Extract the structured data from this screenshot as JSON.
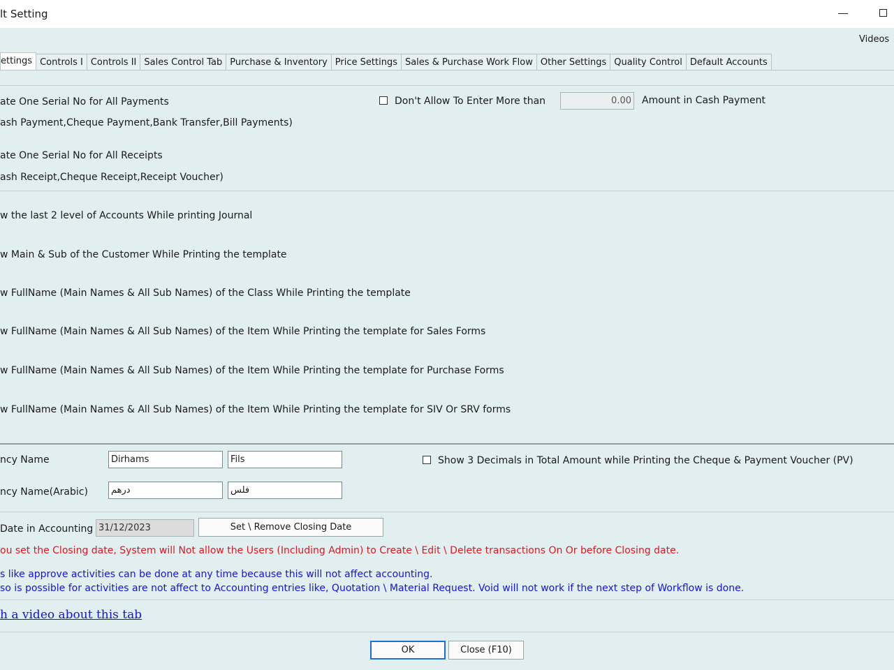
{
  "window": {
    "title": "lt Setting"
  },
  "header": {
    "videos_link": "Videos"
  },
  "tabs": [
    {
      "label": "ettings",
      "active": true
    },
    {
      "label": "Controls I"
    },
    {
      "label": "Controls II"
    },
    {
      "label": "Sales Control Tab"
    },
    {
      "label": "Purchase & Inventory"
    },
    {
      "label": "Price Settings"
    },
    {
      "label": "Sales & Purchase Work Flow"
    },
    {
      "label": "Other Settings"
    },
    {
      "label": "Quality Control"
    },
    {
      "label": "Default Accounts"
    }
  ],
  "serial": {
    "payments_label": "ate One Serial No for All Payments",
    "payments_desc": "ash Payment,Cheque Payment,Bank Transfer,Bill Payments)",
    "receipts_label": "ate One Serial No for All Receipts",
    "receipts_desc": "ash Receipt,Cheque Receipt,Receipt Voucher)"
  },
  "cash_limit": {
    "label": "Don't Allow To Enter More than",
    "value": "0.00",
    "suffix": "Amount in Cash Payment"
  },
  "print_options": [
    "w the last 2 level of Accounts While printing Journal",
    "w Main & Sub of the Customer While Printing the template",
    "w FullName (Main Names & All Sub Names) of the Class While Printing the template",
    "w FullName (Main Names & All Sub Names) of the Item While Printing the template for Sales Forms",
    "w FullName (Main Names & All Sub Names) of the Item While Printing the template for Purchase Forms",
    "w FullName (Main Names & All Sub Names) of the Item While Printing the template for SIV Or SRV forms"
  ],
  "currency": {
    "name_label": "ncy Name",
    "main_value": "Dirhams",
    "sub_value": "Fils",
    "arabic_label": "ncy Name(Arabic)",
    "arabic_main_value": "درهم",
    "arabic_sub_value": "فلس",
    "decimals_label": "Show 3 Decimals in Total Amount while Printing the Cheque & Payment Voucher (PV)"
  },
  "closing": {
    "label": "Date in Accounting",
    "date_value": "31/12/2023",
    "button_label": "Set \\ Remove Closing Date",
    "warning": "ou set the Closing date, System will Not allow the Users (Including Admin)  to Create \\ Edit \\ Delete transactions On Or before Closing date.",
    "info_line1": "s like approve activities can be done at any time because this will not affect accounting.",
    "info_line2": "so is possible for activities are not affect to Accounting entries like, Quotation \\ Material Request. Void will not work if the next step of Workflow is done."
  },
  "video_link": "h a video about this tab",
  "footer": {
    "ok_label": "OK",
    "close_label": "Close (F10)"
  }
}
